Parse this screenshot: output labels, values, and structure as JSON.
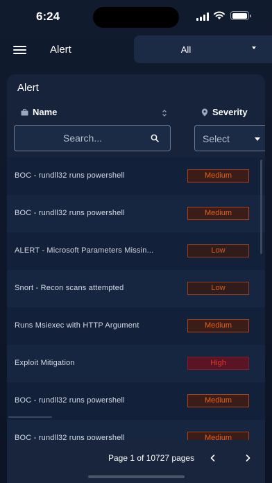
{
  "status_bar": {
    "time": "6:24"
  },
  "header": {
    "title": "Alert",
    "filter_value": "All"
  },
  "card": {
    "title": "Alert",
    "columns": {
      "name": "Name",
      "severity": "Severity"
    },
    "search": {
      "placeholder": "Search..."
    },
    "severity_select": {
      "label": "Select"
    }
  },
  "rows": [
    {
      "name": "BOC - rundll32 runs powershell",
      "severity": "Medium"
    },
    {
      "name": "BOC - rundll32 runs powershell",
      "severity": "Medium"
    },
    {
      "name": "ALERT - Microsoft Parameters Missin...",
      "severity": "Low"
    },
    {
      "name": "Snort - Recon scans attempted",
      "severity": "Low"
    },
    {
      "name": "Runs Msiexec with HTTP Argument",
      "severity": "Medium"
    },
    {
      "name": "Exploit Mitigation",
      "severity": "High"
    },
    {
      "name": "BOC - rundll32 runs powershell",
      "severity": "Medium"
    },
    {
      "name": "BOC - rundll32 runs powershell",
      "severity": "Medium"
    }
  ],
  "pagination": {
    "text": "Page 1 of 10727 pages"
  },
  "colors": {
    "background": "#0d1526",
    "card": "#16233b",
    "medium": "#e2621b",
    "low": "#d3602a",
    "high": "#e03535"
  },
  "icons": {
    "menu": "hamburger-icon",
    "name_column": "briefcase-icon",
    "severity_column": "location-pin-icon",
    "sort": "sort-arrows-icon",
    "search": "search-icon",
    "prev": "chevron-left-icon",
    "next": "chevron-right-icon"
  }
}
